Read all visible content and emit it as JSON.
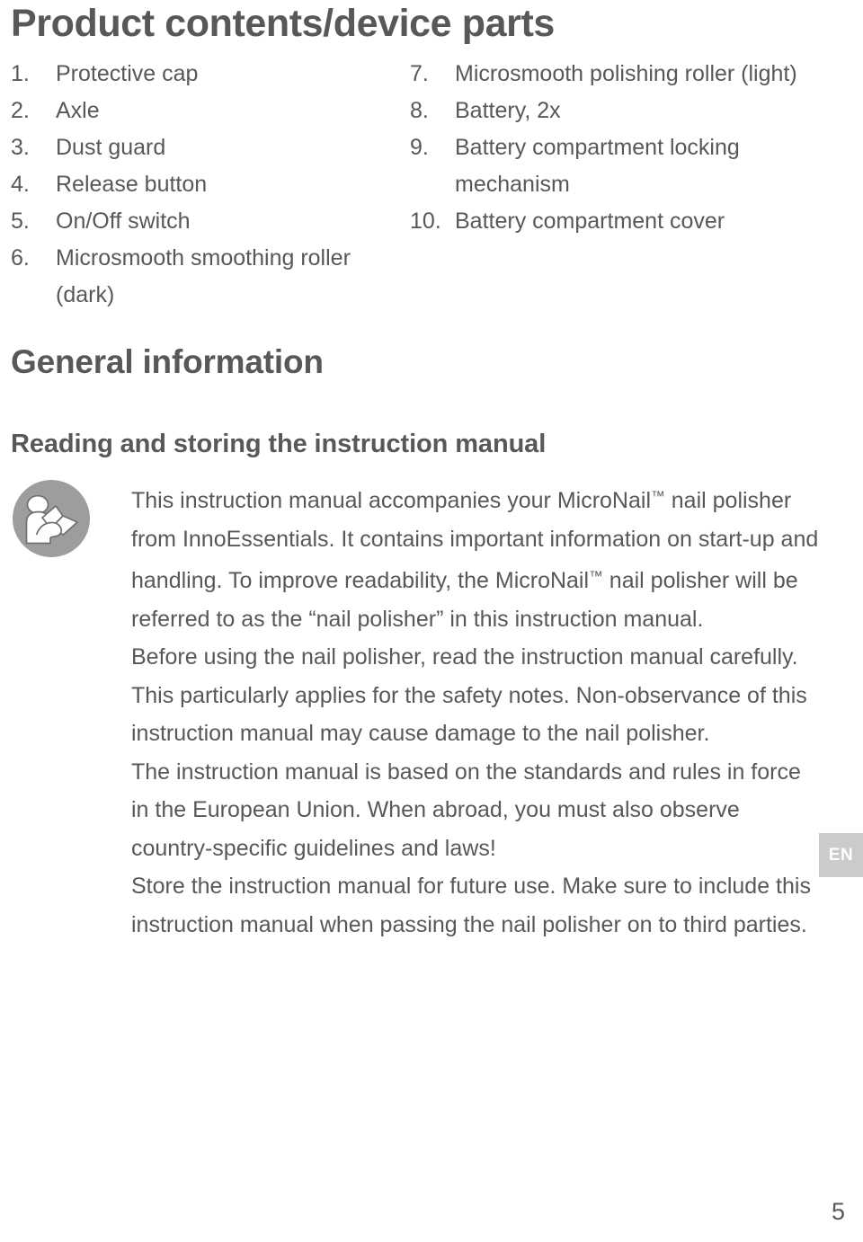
{
  "document": {
    "title": "Product contents/device parts",
    "page_number": "5",
    "language_tab": "EN",
    "text_color": "#58585a",
    "tab_color": "#cbcbcb"
  },
  "parts_list": {
    "left_column": [
      {
        "number": "1.",
        "label": "Protective cap"
      },
      {
        "number": "2.",
        "label": "Axle"
      },
      {
        "number": "3.",
        "label": "Dust guard"
      },
      {
        "number": "4.",
        "label": "Release button"
      },
      {
        "number": "5.",
        "label": "On/Off switch"
      },
      {
        "number": "6.",
        "label": "Microsmooth smoothing roller (dark)"
      }
    ],
    "right_column": [
      {
        "number": "7.",
        "label": "Microsmooth polishing roller (light)"
      },
      {
        "number": "8.",
        "label": "Battery, 2x"
      },
      {
        "number": "9.",
        "label": "Battery compartment locking mechanism"
      },
      {
        "number": "10.",
        "label": "Battery compartment cover"
      }
    ]
  },
  "sections": {
    "general_information": {
      "heading": "General information",
      "subheading": "Reading and storing the instruction manual",
      "icon": "read-manual-icon",
      "paragraphs": {
        "p1_a": "This instruction manual accompanies your MicroNail",
        "p1_tm1": "™",
        "p1_b": " nail polisher from InnoEssentials. It contains important information on start-up and handling. To improve readability, the MicroNail",
        "p1_tm2": "™",
        "p1_c": " nail polisher will be referred to as the “nail polisher” in this instruction manual.",
        "p2": "Before using the nail polisher, read the instruction manual carefully. This particularly applies for the safety notes. Non-observance of this instruction manual may cause damage to the nail polisher.",
        "p3": "The instruction manual is based on the standards and rules in force in the European Union. When abroad, you must also observe country-specific guidelines and laws!",
        "p4": "Store the instruction manual for future use. Make sure to include this instruction manual when passing the nail polisher on to third parties."
      }
    }
  }
}
